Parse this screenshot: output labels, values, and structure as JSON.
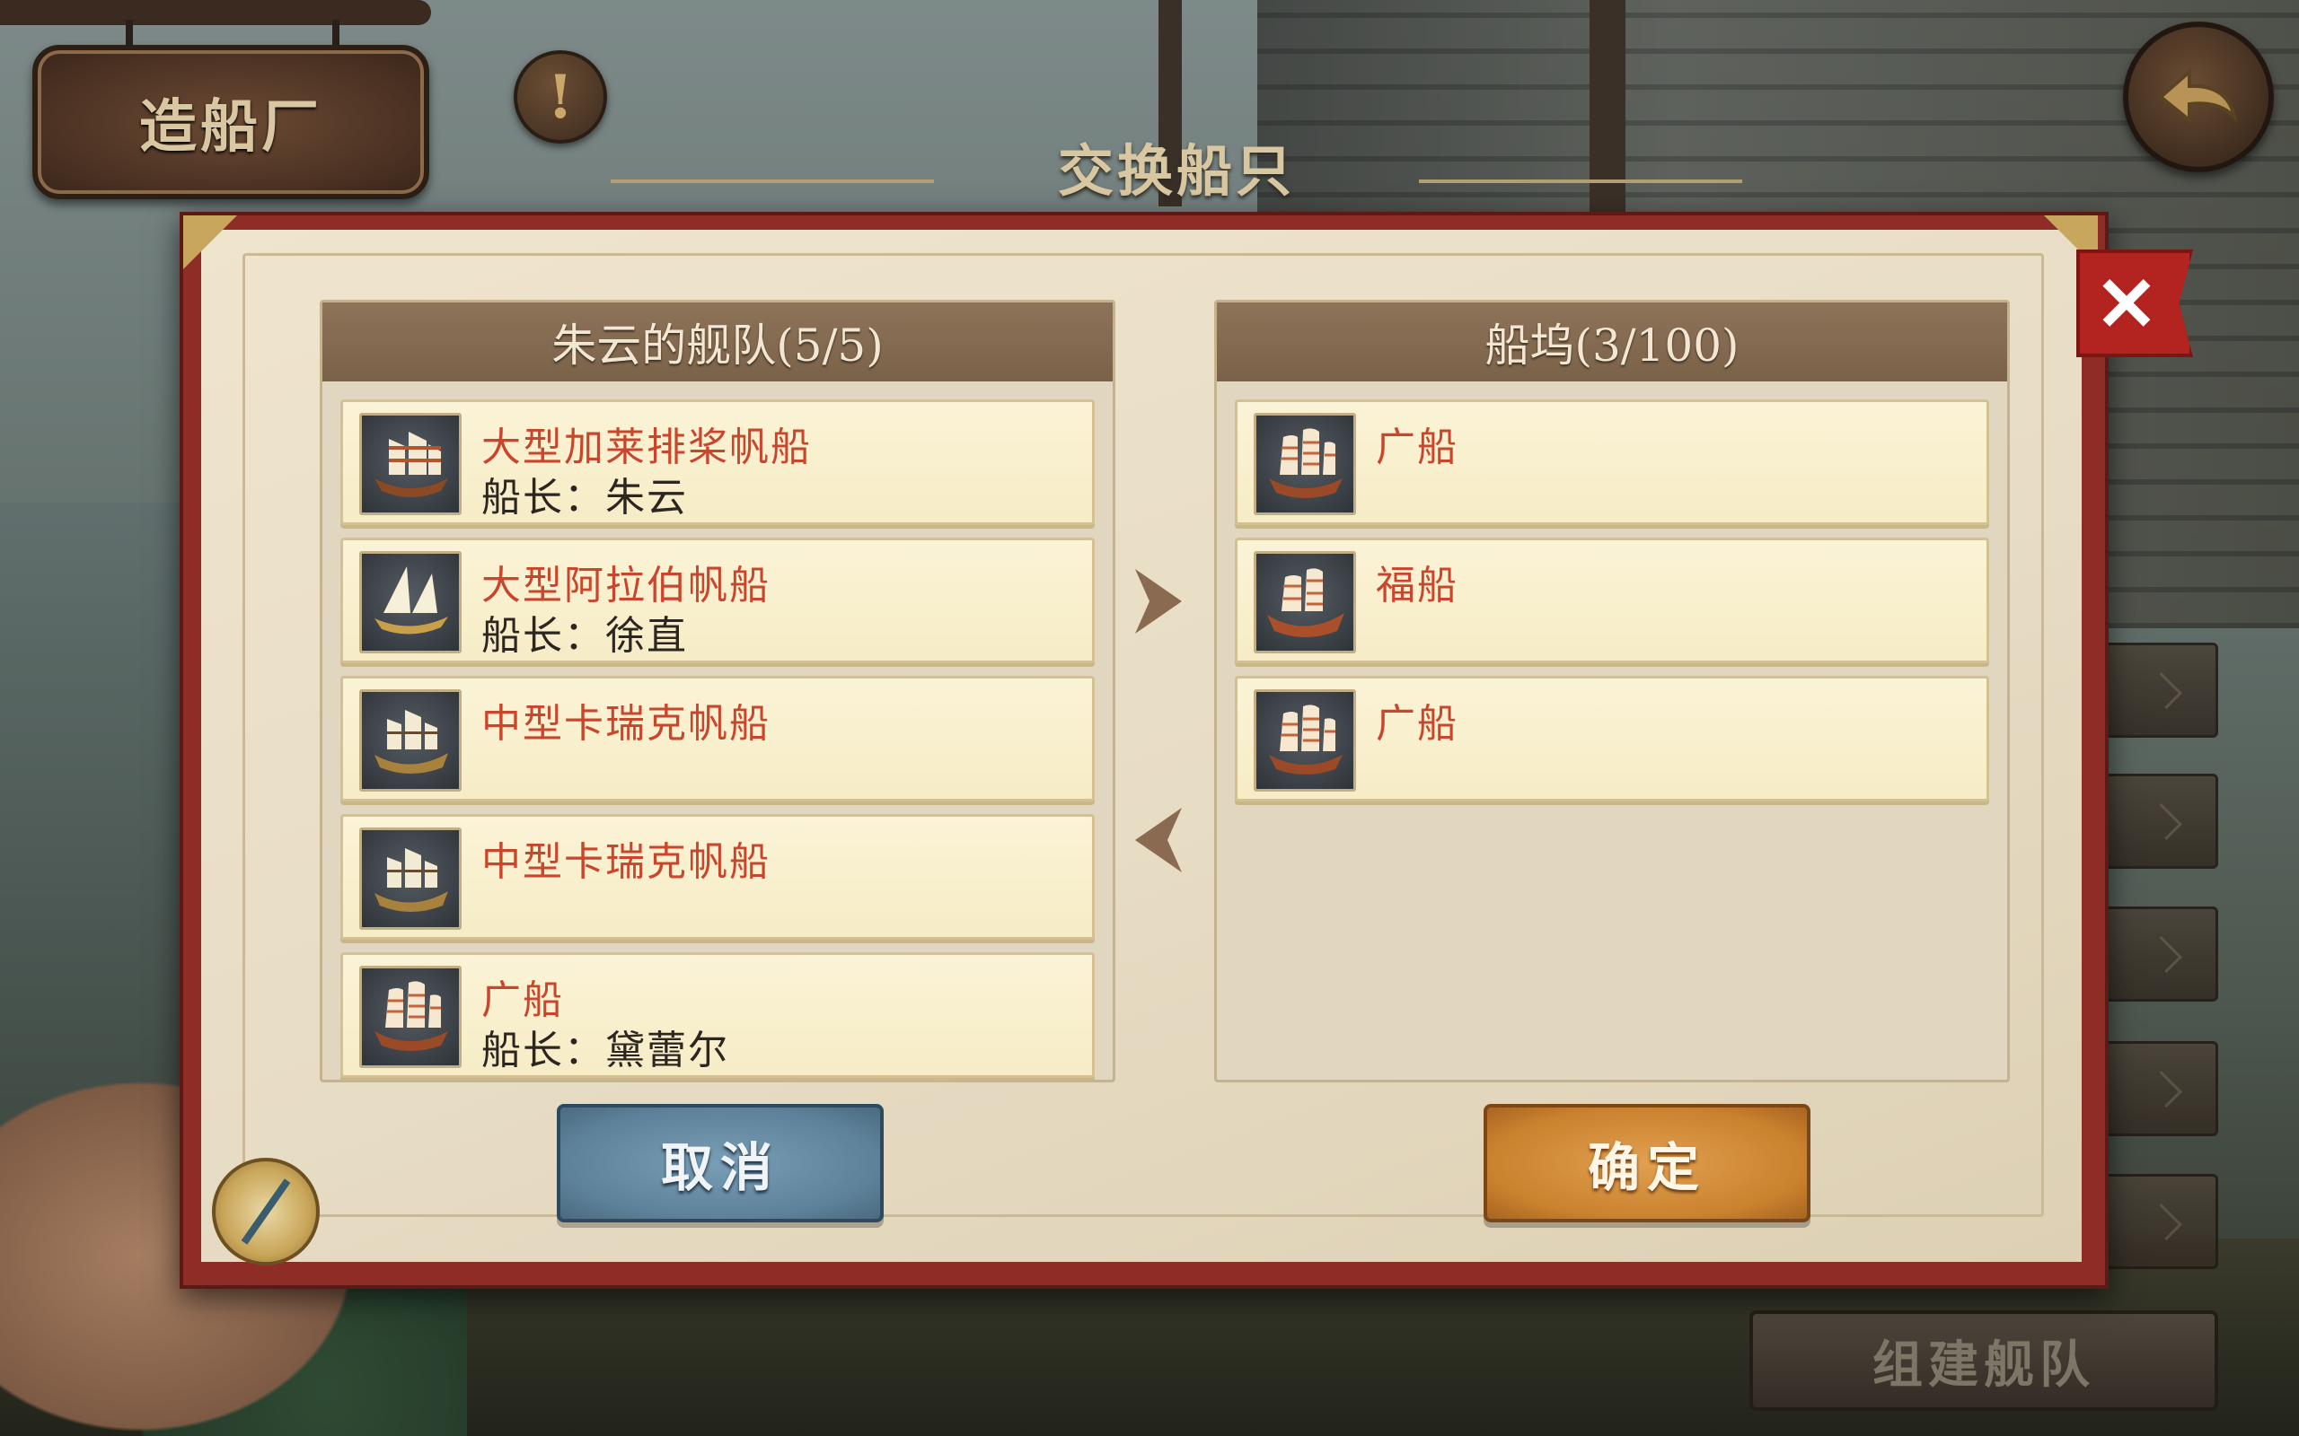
{
  "location_sign": "造船厂",
  "alert_symbol": "!",
  "dialog_title": "交换船只",
  "close_symbol": "✕",
  "left_list": {
    "header": "朱云的舰队(5/5)",
    "ships": [
      {
        "name": "大型加莱排桨帆船",
        "captain": "船长：朱云",
        "icon": "galley-icon"
      },
      {
        "name": "大型阿拉伯帆船",
        "captain": "船长：徐直",
        "icon": "dhow-icon"
      },
      {
        "name": "中型卡瑞克帆船",
        "captain": "",
        "icon": "carrack-icon"
      },
      {
        "name": "中型卡瑞克帆船",
        "captain": "",
        "icon": "carrack-icon"
      },
      {
        "name": "广船",
        "captain": "船长：黛蕾尔",
        "icon": "junk-icon"
      }
    ]
  },
  "right_list": {
    "header": "船坞(3/100)",
    "ships": [
      {
        "name": "广船",
        "captain": "",
        "icon": "junk-icon"
      },
      {
        "name": "福船",
        "captain": "",
        "icon": "fuchuan-icon"
      },
      {
        "name": "广船",
        "captain": "",
        "icon": "junk-icon"
      }
    ]
  },
  "buttons": {
    "cancel": "取消",
    "confirm": "确定",
    "build_fleet": "组建舰队"
  },
  "colors": {
    "ship_name": "#c9452c",
    "panel_frame": "#8e2c26",
    "cancel_button": "#5d8199",
    "confirm_button": "#c9822e"
  }
}
